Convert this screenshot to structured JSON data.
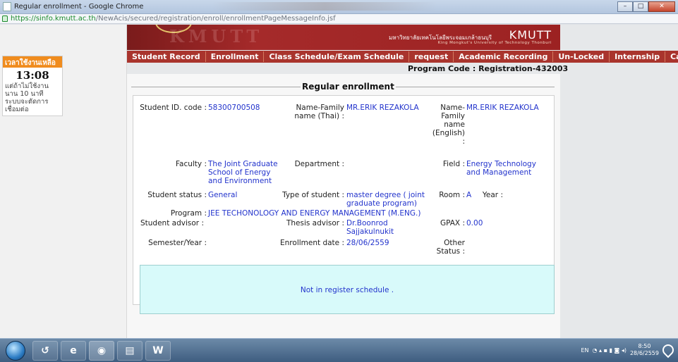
{
  "window": {
    "title": "Regular enrollment - Google Chrome",
    "url_host": "https://sinfo.kmutt.ac.th",
    "url_path": "/NewAcis/secured/registration/enroll/enrollmentPageMessageInfo.jsf"
  },
  "sidebar": {
    "timer_header": "เวลาใช้งานเหลือ",
    "timer_value": "13:08",
    "timer_note": "แต่ถ้าไม่ใช้งาน นาน 10 นาที ระบบจะตัดการ เชื่อมต่อ"
  },
  "banner": {
    "uni_thai": "มหาวิทยาลัยเทคโนโลยีพระจอมเกล้าธนบุรี",
    "uni_en": "King Mongkut's University of Technology Thonburi",
    "acronym": "KMUTT"
  },
  "nav": {
    "items": [
      "Student Record",
      "Enrollment",
      "Class Schedule/Exam Schedule",
      "request",
      "Academic Recording",
      "Un-Locked",
      "Internship",
      "Career S"
    ]
  },
  "program_code": "Program Code : Registration-432003",
  "section_title": "Regular enrollment",
  "student": {
    "id_label": "Student ID. code :",
    "id_value": "58300700508",
    "name_thai_label": "Name-Family name (Thai) :",
    "name_thai_value": "MR.ERIK REZAKOLA",
    "name_en_label": "Name- Family name (English) :",
    "name_en_value": "MR.ERIK REZAKOLA",
    "faculty_label": "Faculty :",
    "faculty_value": "The Joint Graduate School of Energy and Environment",
    "department_label": "Department :",
    "department_value": "",
    "field_label": "Field :",
    "field_value": "Energy Technology and Management",
    "status_label": "Student status :",
    "status_value": "General",
    "type_label": "Type of student :",
    "type_value": "master degree ( joint graduate program)",
    "room_label": "Room :",
    "room_value": "A",
    "year_label": "Year :",
    "year_value": "",
    "program_label": "Program :",
    "program_value": "JEE TECHONOLOGY AND ENERGY MANAGEMENT (M.ENG.)",
    "advisor_label": "Student advisor :",
    "advisor_value": "",
    "thesis_label": "Thesis advisor :",
    "thesis_value": "Dr.Boonrod Sajjakulnukit",
    "gpax_label": "GPAX :",
    "gpax_value": "0.00",
    "semester_label": "Semester/Year :",
    "semester_value": "",
    "enroll_date_label": "Enrollment date :",
    "enroll_date_value": "28/06/2559",
    "other_status_label": "Other Status :",
    "other_status_value": ""
  },
  "notice": "Not in register schedule .",
  "taskbar": {
    "tray_lang": "EN",
    "time": "8:50",
    "date": "28/6/2559"
  }
}
